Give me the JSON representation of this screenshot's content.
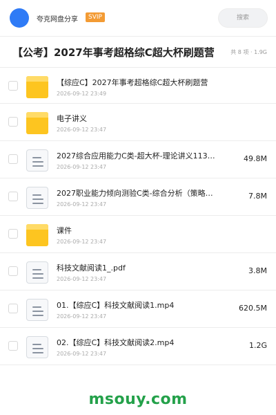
{
  "header": {
    "share_name": "夸克网盘分享",
    "badge": "SVIP",
    "search_placeholder": "搜索"
  },
  "folder": {
    "title": "【公考】2027年事考超格综C超大杯刷题营",
    "count": "共 8 项 · 1.9G"
  },
  "files": [
    {
      "type": "folder",
      "name": "【综应C】2027年事考超格综C超大杯刷题营",
      "date": "2026-09-12 23:49",
      "size": ""
    },
    {
      "type": "folder",
      "name": "电子讲义",
      "date": "2026-09-12 23:47",
      "size": ""
    },
    {
      "type": "file",
      "name": "2027综合应用能力C类-超大杯-理论讲义1130…",
      "date": "2026-09-12 23:47",
      "size": "49.8M"
    },
    {
      "type": "file",
      "name": "2027职业能力倾向测验C类-综合分析（策略制定和…",
      "date": "2026-09-12 23:47",
      "size": "7.8M"
    },
    {
      "type": "folder",
      "name": "课件",
      "date": "2026-09-12 23:47",
      "size": ""
    },
    {
      "type": "file",
      "name": "科技文献阅读1_.pdf",
      "date": "2026-09-12 23:47",
      "size": "3.8M"
    },
    {
      "type": "file",
      "name": "01.【综应C】科技文献阅读1.mp4",
      "date": "2026-09-12 23:47",
      "size": "620.5M"
    },
    {
      "type": "file",
      "name": "02.【综应C】科技文献阅读2.mp4",
      "date": "2026-09-12 23:47",
      "size": "1.2G"
    }
  ],
  "watermark": "msouy.com",
  "colors": {
    "accent": "#2f7bf6",
    "svip": "#f39b34",
    "folder": "#fdc520",
    "watermark": "#24a14a"
  }
}
